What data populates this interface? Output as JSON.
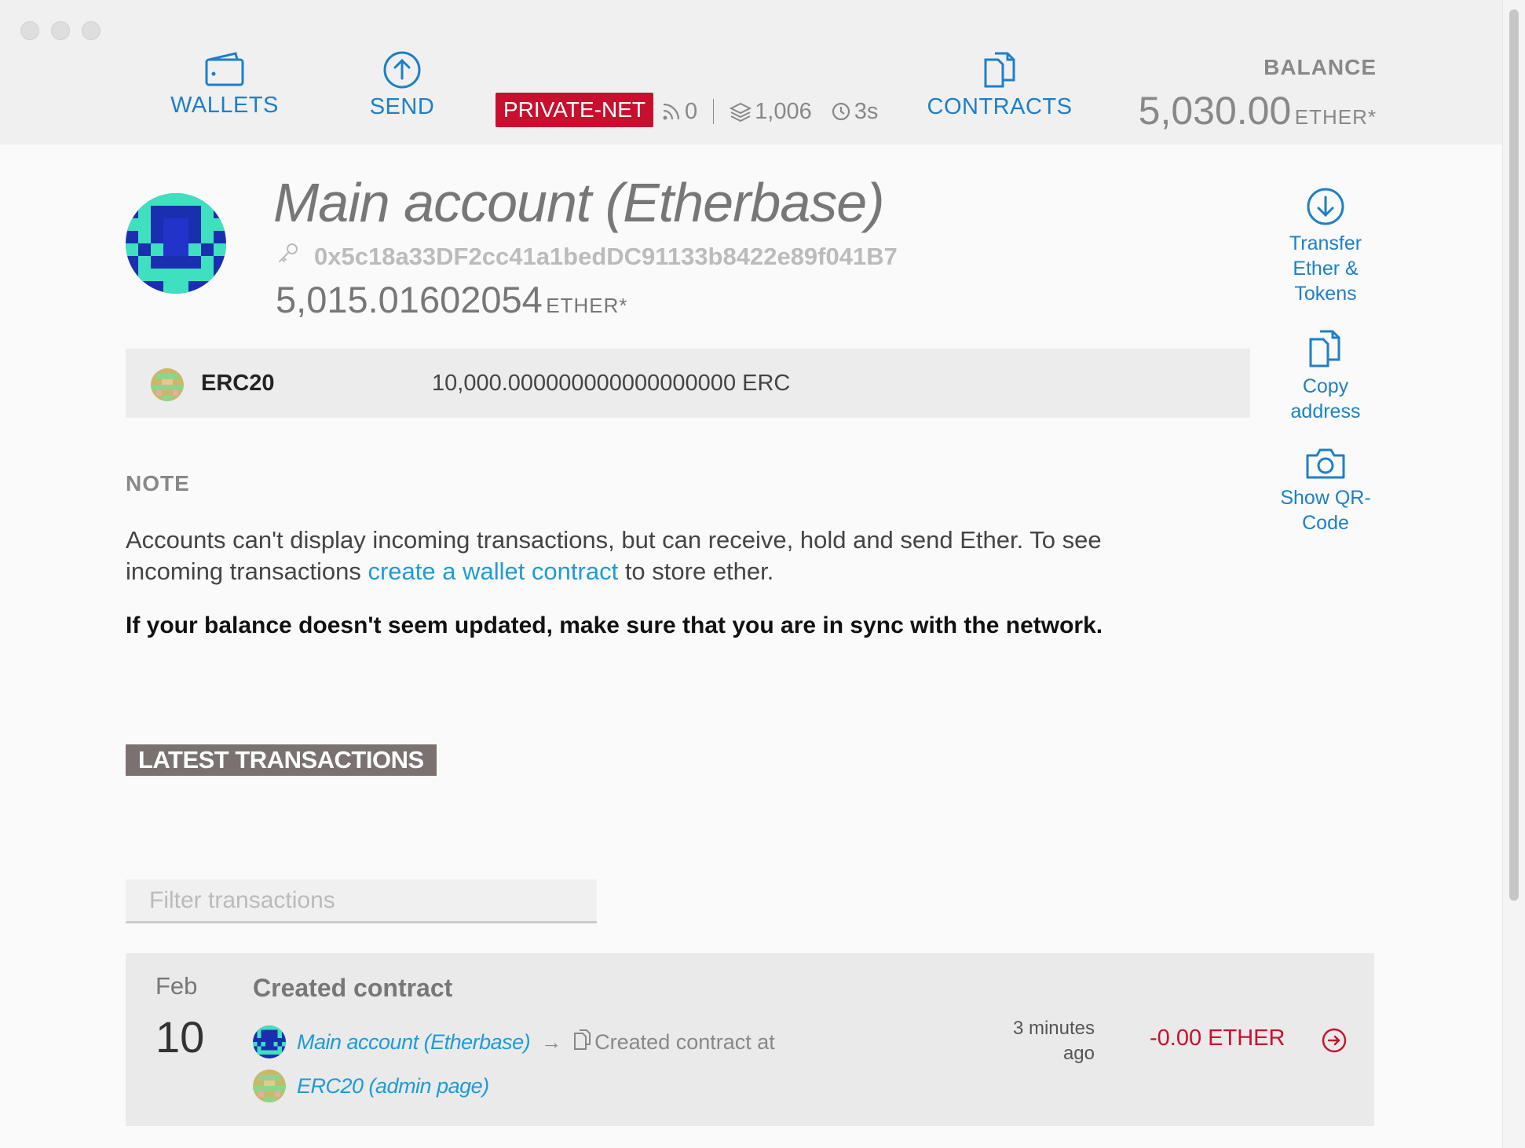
{
  "header": {
    "nav": {
      "wallets": "WALLETS",
      "send": "SEND",
      "contracts": "CONTRACTS"
    },
    "network": {
      "badge": "PRIVATE-NET",
      "peers": "0",
      "blocks": "1,006",
      "time": "3s"
    },
    "balance": {
      "title": "BALANCE",
      "value": "5,030.00",
      "unit": "ETHER*"
    }
  },
  "account": {
    "name": "Main account (Etherbase)",
    "address": "0x5c18a33DF2cc41a1bedDC91133b8422e89f041B7",
    "balance": "5,015.01602054",
    "unit": "ETHER*"
  },
  "tokens": [
    {
      "name": "ERC20",
      "balance": "10,000.000000000000000000 ERC"
    }
  ],
  "actions": {
    "transfer": [
      "Transfer",
      "Ether &",
      "Tokens"
    ],
    "copy": [
      "Copy",
      "address"
    ],
    "qr": [
      "Show QR-",
      "Code"
    ]
  },
  "note": {
    "heading": "NOTE",
    "text_before": "Accounts can't display incoming transactions, but can receive, hold and send Ether. To see incoming transactions ",
    "link": "create a wallet contract",
    "text_after": " to store ether.",
    "warning": "If your balance doesn't seem updated, make sure that you are in sync with the network."
  },
  "transactions": {
    "heading": "LATEST TRANSACTIONS",
    "filter_placeholder": "Filter transactions",
    "items": [
      {
        "month": "Feb",
        "day": "10",
        "title": "Created contract",
        "from": "Main account (Etherbase)",
        "action_text": "Created contract at",
        "to": "ERC20 (admin page)",
        "time_line1": "3 minutes",
        "time_line2": "ago",
        "amount": "-0.00 ETHER"
      }
    ]
  },
  "colors": {
    "accent": "#1e7fc7",
    "link": "#1e9bd8",
    "network_badge": "#c8102e",
    "negative_amount": "#c8102e",
    "section_heading_bg": "#7a7171"
  },
  "icons": {
    "wallets": "wallet-icon",
    "send": "arrow-up-circle-icon",
    "contracts": "documents-icon",
    "peers": "signal-icon",
    "blocks": "layers-icon",
    "time": "clock-icon",
    "key": "key-icon",
    "transfer": "arrow-down-circle-icon",
    "copy": "copy-icon",
    "qr": "camera-icon",
    "tx_open": "arrow-right-circle-icon"
  }
}
